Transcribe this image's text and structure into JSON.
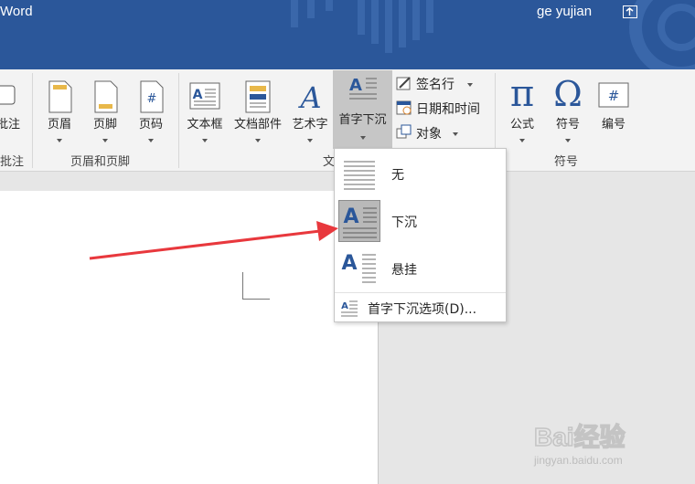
{
  "app": {
    "title": "Word",
    "user": "ge yujian"
  },
  "ribbon": {
    "partial_left_label": "批注",
    "partial_left_group": "批注",
    "header_footer": {
      "buttons": [
        {
          "label": "页眉"
        },
        {
          "label": "页脚"
        },
        {
          "label": "页码"
        }
      ],
      "group_label": "页眉和页脚"
    },
    "text": {
      "buttons": [
        {
          "label": "文本框"
        },
        {
          "label": "文档部件"
        },
        {
          "label": "艺术字"
        },
        {
          "label": "首字下沉"
        }
      ],
      "small": [
        {
          "label": "签名行"
        },
        {
          "label": "日期和时间"
        },
        {
          "label": "对象"
        }
      ],
      "group_label_visible": "文"
    },
    "symbols": {
      "buttons": [
        {
          "label": "公式"
        },
        {
          "label": "符号"
        },
        {
          "label": "编号"
        }
      ],
      "group_label": "符号"
    }
  },
  "dropcap_menu": {
    "items": [
      {
        "label": "无"
      },
      {
        "label": "下沉",
        "selected": true
      },
      {
        "label": "悬挂"
      }
    ],
    "options_label": "首字下沉选项(D)..."
  },
  "colors": {
    "title_bar": "#2b579a",
    "ribbon_bg": "#f3f3f3",
    "annotation_arrow": "#e8383d"
  },
  "watermark": {
    "brand": "Bai经验",
    "url": "jingyan.baidu.com"
  }
}
